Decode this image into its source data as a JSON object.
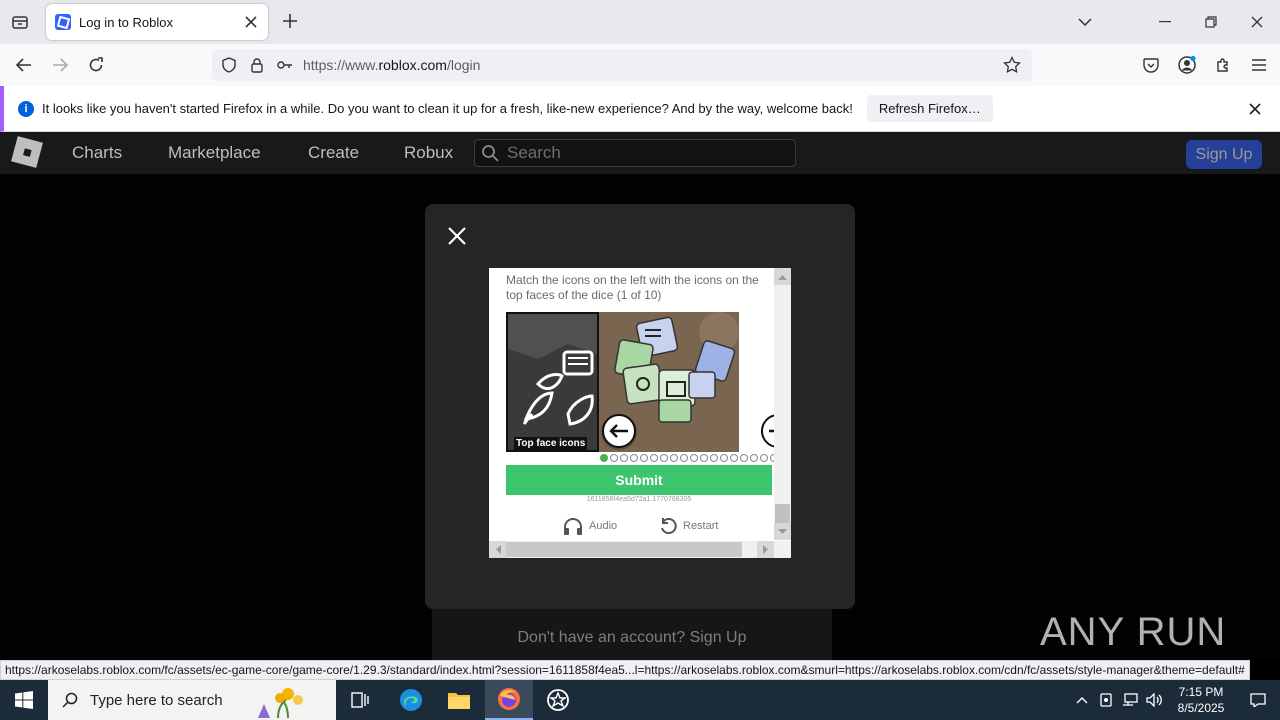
{
  "browser": {
    "tab_title": "Log in to Roblox",
    "url_prefix": "https://www.",
    "url_domain": "roblox.com",
    "url_path": "/login",
    "notification_text": "It looks like you haven't started Firefox in a while. Do you want to clean it up for a fresh, like-new experience? And by the way, welcome back!",
    "notification_button": "Refresh Firefox…",
    "status_url": "https://arkoselabs.roblox.com/fc/assets/ec-game-core/game-core/1.29.3/standard/index.html?session=1611858f4ea5...l=https://arkoselabs.roblox.com&smurl=https://arkoselabs.roblox.com/cdn/fc/assets/style-manager&theme=default#"
  },
  "roblox": {
    "nav": [
      "Charts",
      "Marketplace",
      "Create",
      "Robux"
    ],
    "search_placeholder": "Search",
    "signup_button": "Sign Up",
    "signup_prompt": "Don't have an account? Sign Up"
  },
  "captcha": {
    "instruction": "Match the icons on the left with the icons on the top faces of the dice (1 of 10)",
    "left_label": "Top face icons",
    "submit": "Submit",
    "session_id": "1611858f4ea5d72a1.1770768305",
    "audio": "Audio",
    "restart": "Restart",
    "progress_current": 1,
    "progress_total": 18
  },
  "watermark": "ANY RUN",
  "taskbar": {
    "search_placeholder": "Type here to search",
    "time": "7:15 PM",
    "date": "8/5/2025"
  },
  "colors": {
    "roblox_blue": "#335fff",
    "captcha_green": "#3cc46f",
    "notification_accent": "#a45bff"
  }
}
